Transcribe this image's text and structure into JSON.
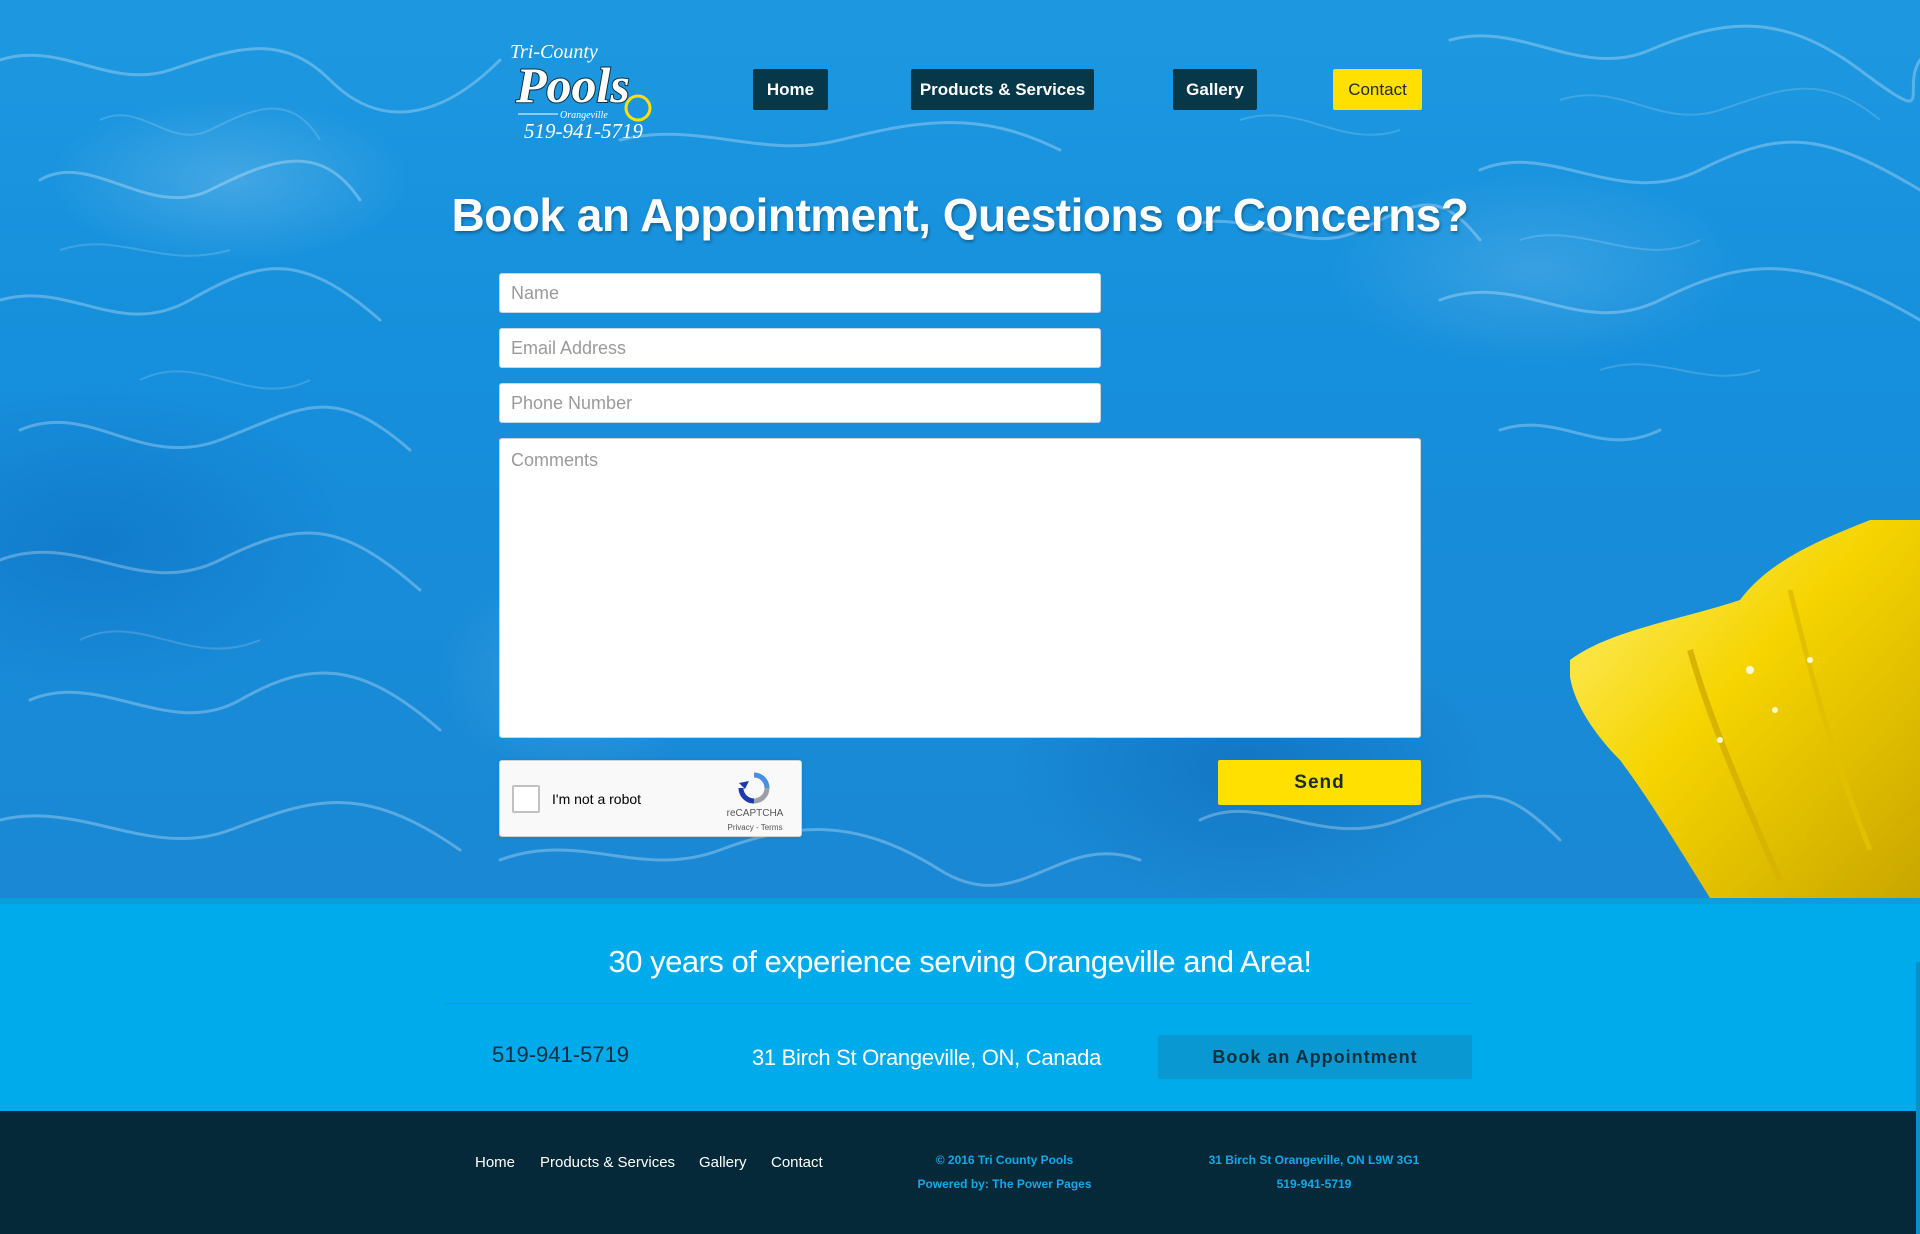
{
  "brand": {
    "name_line1": "Tri-County",
    "name_line2": "Pools",
    "town": "Orangeville",
    "phone": "519-941-5719"
  },
  "nav": {
    "items": [
      {
        "label": "Home"
      },
      {
        "label": "Products & Services"
      },
      {
        "label": "Gallery"
      },
      {
        "label": "Contact"
      }
    ],
    "active": "Contact"
  },
  "form": {
    "title": "Book an Appointment, Questions or Concerns?",
    "name_placeholder": "Name",
    "email_placeholder": "Email Address",
    "phone_placeholder": "Phone Number",
    "comments_placeholder": "Comments",
    "captcha_label": "I'm not a robot",
    "captcha_brand": "reCAPTCHA",
    "captcha_links": "Privacy - Terms",
    "send_label": "Send"
  },
  "info": {
    "tagline": "30 years of experience serving Orangeville and Area!",
    "phone": "519-941-5719",
    "address": "31 Birch St Orangeville, ON, Canada",
    "book_label": "Book an Appointment"
  },
  "footer": {
    "links": [
      {
        "label": "Home"
      },
      {
        "label": "Products & Services"
      },
      {
        "label": "Gallery"
      },
      {
        "label": "Contact"
      }
    ],
    "copyright": "© 2016 Tri County Pools",
    "powered": "Powered by: The Power Pages",
    "address": "31 Birch St Orangeville, ON L9W 3G1",
    "phone": "519-941-5719"
  },
  "colors": {
    "water": "#1a90dc",
    "nav_dark": "#06384a",
    "accent_yellow": "#ffe000",
    "info_band": "#00abec",
    "footer_bg": "#06293a",
    "footer_text": "#14a8e8"
  }
}
